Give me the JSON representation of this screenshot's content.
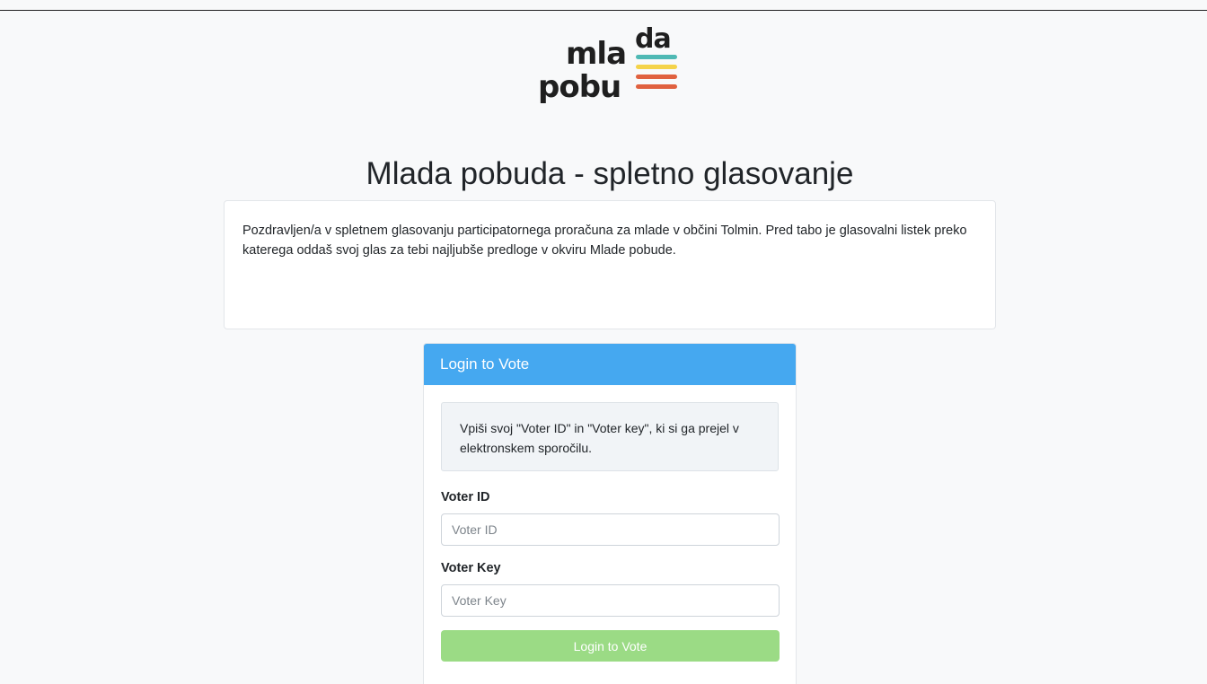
{
  "logo": {
    "line1_left": "mla",
    "line1_top": "da",
    "line2": "pobu",
    "stripe_colors": [
      "#4fb9b4",
      "#f4d34a",
      "#e0613f",
      "#e0613f"
    ]
  },
  "page_title": "Mlada pobuda - spletno glasovanje",
  "intro": {
    "text": "Pozdravljen/a v spletnem glasovanju participatornega proračuna za mlade v občini Tolmin. Pred tabo je glasovalni listek preko katerega oddaš svoj glas za tebi najljubše predloge v okviru Mlade pobude."
  },
  "login": {
    "header": "Login to Vote",
    "notice": "Vpiši svoj \"Voter ID\" in \"Voter key\", ki si ga prejel v elektronskem sporočilu.",
    "voter_id_label": "Voter ID",
    "voter_id_placeholder": "Voter ID",
    "voter_id_value": "",
    "voter_key_label": "Voter Key",
    "voter_key_placeholder": "Voter Key",
    "voter_key_value": "",
    "submit_label": "Login to Vote",
    "header_color": "#45a8f0",
    "submit_color": "#9bdb85"
  }
}
